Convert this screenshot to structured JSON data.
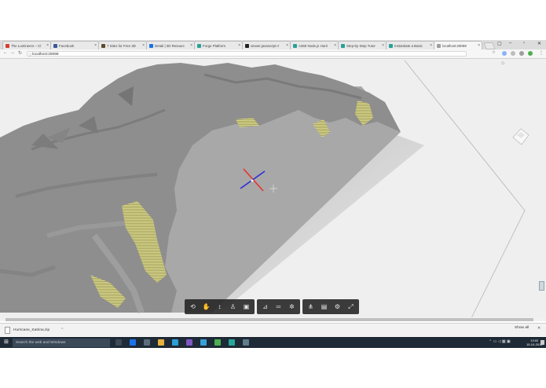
{
  "browser": {
    "tabs": [
      {
        "label": "The Lumineers – Cl",
        "color": "#d23f31"
      },
      {
        "label": "Facebook",
        "color": "#3b5998"
      },
      {
        "label": "7 Sites for Free 3D",
        "color": "#5b4a2c"
      },
      {
        "label": "Detail | 3D Resourc",
        "color": "#1a73e8"
      },
      {
        "label": "Forge Platform",
        "color": "#2aa198"
      },
      {
        "label": "viewer.javascript rr",
        "color": "#222222"
      },
      {
        "label": "A360 Node.js Hurri",
        "color": "#2aa198"
      },
      {
        "label": "Step-by-Step Tutor",
        "color": "#2aa198"
      },
      {
        "label": "Instantiate a Basic",
        "color": "#2aa198"
      },
      {
        "label": "localhost:29098",
        "color": "#9e9e9e"
      }
    ],
    "url": "localhost:29098"
  },
  "toolbar": {
    "groups": [
      [
        "orbit-icon",
        "pan-icon",
        "zoom-icon",
        "first-person-icon",
        "camera-icon"
      ],
      [
        "measure-icon",
        "section-icon",
        "explode-icon"
      ],
      [
        "model-browser-icon",
        "properties-icon",
        "settings-icon",
        "fullscreen-icon"
      ]
    ]
  },
  "download": {
    "filename": "Hurricane_Katrina.zip",
    "show_all": "Show all"
  },
  "taskbar": {
    "search_placeholder": "Search the web and Windows",
    "time": "13:02",
    "date": "15-10-2016"
  },
  "colors": {
    "terrain": "#8e8e8e",
    "water": "#a9a9a9",
    "land_hatch": "#dcd98a",
    "viewer_bg": "#efefef",
    "taskbar": "#1e2a36"
  }
}
